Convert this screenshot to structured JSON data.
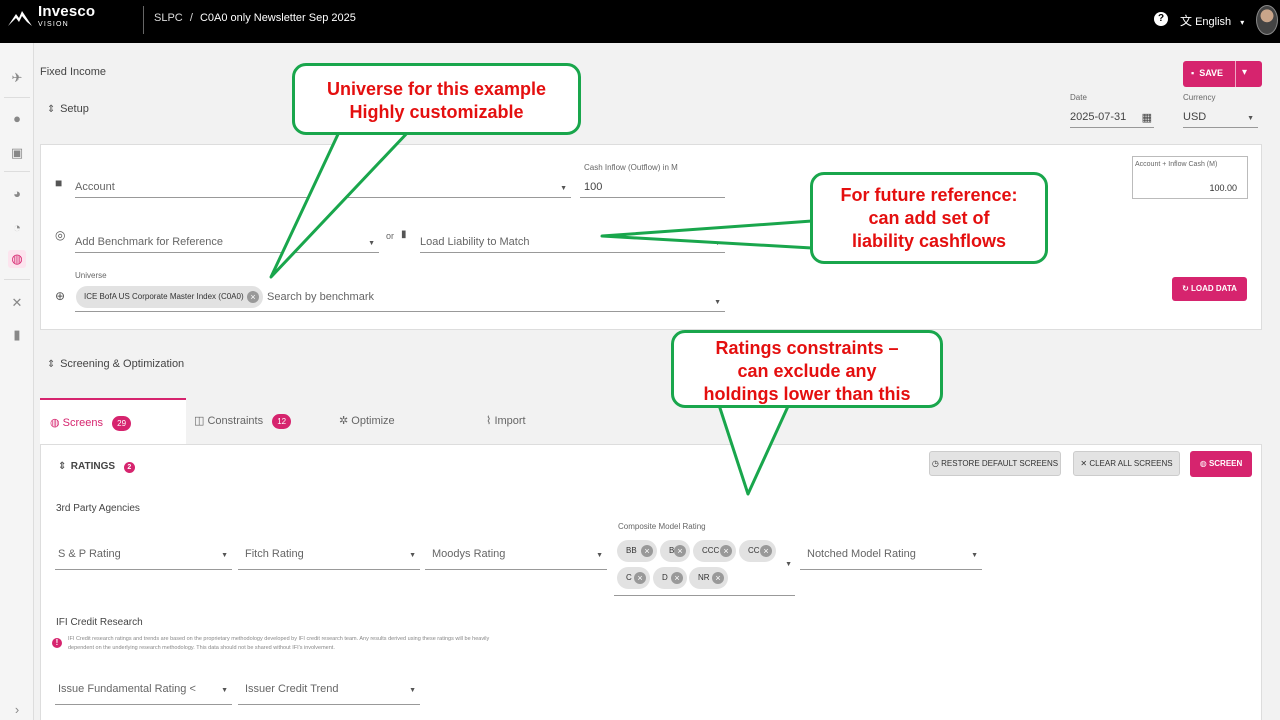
{
  "header": {
    "brand": "Invesco",
    "brand_sub": "VISION",
    "breadcrumb_root": "SLPC",
    "breadcrumb_sep": "/",
    "breadcrumb_current": "C0A0 only Newsletter Sep 2025",
    "help": "?",
    "language": "English"
  },
  "page": {
    "title": "Fixed Income",
    "setup_label": "Setup",
    "screening_label": "Screening & Optimization",
    "save_label": "SAVE"
  },
  "setup": {
    "date_label": "Date",
    "date_value": "2025-07-31",
    "currency_label": "Currency",
    "currency_value": "USD",
    "account_placeholder": "Account",
    "cash_inflow_label": "Cash Inflow (Outflow) in M",
    "cash_inflow_value": "100",
    "acct_inflow_label": "Account + Inflow Cash (M)",
    "acct_inflow_value": "100.00",
    "benchmark_placeholder": "Add Benchmark for Reference",
    "or_text": "or",
    "liability_placeholder": "Load Liability to Match",
    "universe_label": "Universe",
    "universe_chip": "ICE BofA US Corporate Master Index (C0A0)",
    "universe_search_placeholder": "Search by benchmark",
    "load_data_label": "LOAD DATA"
  },
  "tabs": [
    {
      "label": "Screens",
      "badge": "29"
    },
    {
      "label": "Constraints",
      "badge": "12"
    },
    {
      "label": "Optimize"
    },
    {
      "label": "Import"
    }
  ],
  "ratings": {
    "title": "RATINGS",
    "badge": "2",
    "restore_label": "RESTORE DEFAULT SCREENS",
    "clear_label": "CLEAR ALL SCREENS",
    "screen_label": "SCREEN",
    "agencies_label": "3rd Party Agencies",
    "sp_placeholder": "S & P Rating",
    "fitch_placeholder": "Fitch Rating",
    "moodys_placeholder": "Moodys Rating",
    "composite_label": "Composite Model Rating",
    "composite_chips": [
      "BB",
      "B",
      "CCC",
      "CC",
      "C",
      "D",
      "NR"
    ],
    "notched_placeholder": "Notched Model Rating",
    "ifi_label": "IFI Credit Research",
    "ifi_info": "IFI Credit research ratings and trends are based on the proprietary methodology developed by IFI credit research team. Any results derived using these ratings will be heavily dependent on the underlying research methodology. This data should not be shared without IFI's involvement.",
    "issue_fund_placeholder": "Issue Fundamental Rating <",
    "issuer_trend_placeholder": "Issuer Credit Trend"
  },
  "callouts": {
    "universe": "Universe for this example\nHighly customizable",
    "liability": "For future reference:\ncan add set of\nliability cashflows",
    "ratings": "Ratings constraints –\ncan exclude any\nholdings lower than this"
  },
  "colors": {
    "accent": "#d6246e",
    "callout_border": "#19a64c",
    "callout_text": "#e40f0f"
  }
}
